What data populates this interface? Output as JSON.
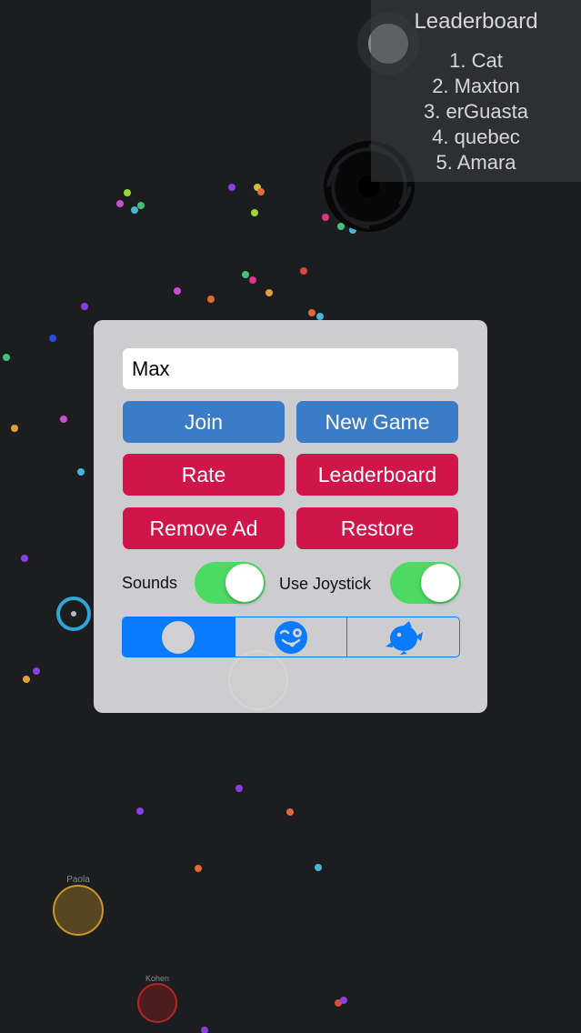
{
  "leaderboard": {
    "title": "Leaderboard",
    "entries": [
      "1. Cat",
      "2. Maxton",
      "3. erGuasta",
      "4. quebec",
      "5. Amara"
    ]
  },
  "players": {
    "paola": "Paola",
    "kohen": "Kohen"
  },
  "menu": {
    "name_value": "Max",
    "join_label": "Join",
    "new_game_label": "New Game",
    "rate_label": "Rate",
    "leaderboard_label": "Leaderboard",
    "remove_ad_label": "Remove Ad",
    "restore_label": "Restore",
    "sounds_label": "Sounds",
    "sounds_on": true,
    "joystick_label": "Use Joystick",
    "joystick_on": true,
    "skin_options": [
      "plain-circle-icon",
      "winking-emoji-icon",
      "fish-icon"
    ],
    "selected_skin": "plain-circle-icon"
  },
  "colors": {
    "background": "#1c1d1f",
    "button_blue": "#3b7cc6",
    "button_red": "#cf1549",
    "toggle_on": "#4cd964",
    "segment_accent": "#0a7aff"
  }
}
